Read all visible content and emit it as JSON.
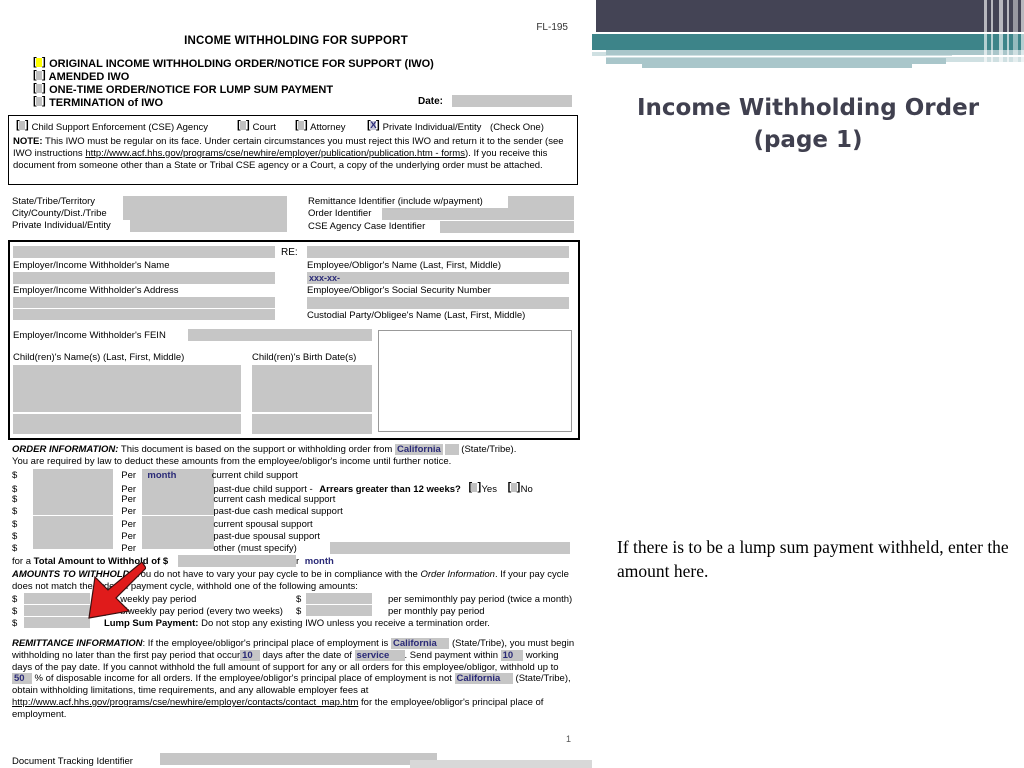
{
  "slide": {
    "title_line1": "Income Withholding Order",
    "title_line2": "(page 1)",
    "annotation": "If there is to be a lump sum payment withheld, enter the amount here.",
    "colors": {
      "navy": "#444455",
      "teal": "#3d8489",
      "pale": "#a9c6ca",
      "pale_light": "#cfe0e2",
      "arrow_red": "#e01b1b",
      "title_text": "#40404f"
    }
  },
  "form": {
    "form_number": "FL-195",
    "title": "INCOME WITHHOLDING FOR SUPPORT",
    "options": [
      {
        "label": "ORIGINAL INCOME WITHHOLDING ORDER/NOTICE FOR SUPPORT (IWO)",
        "checkbox": "highlighted-yellow"
      },
      {
        "label": "AMENDED IWO",
        "checkbox": "empty"
      },
      {
        "label": "ONE-TIME ORDER/NOTICE FOR LUMP SUM PAYMENT",
        "checkbox": "empty"
      },
      {
        "label": "TERMINATION of IWO",
        "checkbox": "empty"
      }
    ],
    "date_label": "Date:",
    "sender_row": {
      "options": [
        {
          "label": "Child Support Enforcement (CSE) Agency",
          "checked": false
        },
        {
          "label": "Court",
          "checked": false
        },
        {
          "label": "Attorney",
          "checked": false
        },
        {
          "label": "Private Individual/Entity",
          "checked": true
        }
      ],
      "instruction": "(Check One)"
    },
    "note": {
      "label": "NOTE:",
      "text1": "This IWO must be regular on its face. Under certain circumstances you must reject this IWO and return it to the sender (see IWO instructions",
      "link": "http://www.acf.hhs.gov/programs/cse/newhire/employer/publication/publication.htm - forms",
      "text2": ").",
      "text3": "If you receive this document from someone other than a State or Tribal CSE agency or a Court, a copy of the underlying order must be attached."
    },
    "id_left": [
      "State/Tribe/Territory",
      "City/County/Dist./Tribe",
      "Private Individual/Entity"
    ],
    "id_right": [
      "Remittance Identifier (include w/payment)",
      "Order Identifier",
      "CSE Agency Case Identifier"
    ],
    "party_box": {
      "re_label": "RE:",
      "employer_name_label": "Employer/Income Withholder's Name",
      "employer_address_label": "Employer/Income Withholder's Address",
      "employer_fein_label": "Employer/Income Withholder's FEIN",
      "employee_name_label": "Employee/Obligor's Name (Last, First, Middle)",
      "ssn_value": "xxx-xx-",
      "ssn_label": "Employee/Obligor's Social Security Number",
      "custodial_label": "Custodial Party/Obligee's Name (Last, First, Middle)",
      "children_names_label": "Child(ren)'s Name(s) (Last, First, Middle)",
      "children_dob_label": "Child(ren)'s Birth Date(s)"
    },
    "order_information": {
      "heading": "ORDER INFORMATION:",
      "intro1": "This document is based on the support or withholding order from",
      "state": "California",
      "state_suffix": "(State/Tribe).",
      "intro2": "You are required by law to deduct these amounts from the employee/obligor's income until further notice.",
      "rows": [
        {
          "per": "month",
          "desc": "current child support"
        },
        {
          "per": "",
          "desc": "past-due child support -"
        },
        {
          "per": "",
          "desc": "current cash medical support"
        },
        {
          "per": "",
          "desc": "past-due cash medical support"
        },
        {
          "per": "",
          "desc": "current spousal support"
        },
        {
          "per": "",
          "desc": "past-due spousal support"
        },
        {
          "per": "",
          "desc": "other (must specify)"
        }
      ],
      "arrears_question": "Arrears greater than 12 weeks?",
      "arrears_yes": "Yes",
      "arrears_no": "No",
      "total_prefix": "for a",
      "total_bold": "Total Amount to Withhold",
      "total_of": "of $",
      "total_per": "per",
      "total_per_value": "month"
    },
    "amounts_to_withhold": {
      "heading": "AMOUNTS TO WITHHOLD:",
      "intro": "You do not have to vary your pay cycle to be in compliance with the",
      "intro_italic": "Order Information",
      "intro2": ". If your pay cycle does not match the ordered payment cycle, withhold one of the following amounts:",
      "left_rows": [
        "per weekly pay period",
        "per biweekly pay period (every two weeks)"
      ],
      "right_rows": [
        "per semimonthly pay period (twice a month)",
        "per monthly pay period"
      ],
      "lump_sum_label": "Lump Sum Payment:",
      "lump_sum_text": "Do not stop any existing IWO unless you receive a termination order."
    },
    "remittance": {
      "heading": "REMITTANCE INFORMATION",
      "t1": ": If the employee/obligor's principal place of employment is",
      "state1": "California",
      "t2": "(State/Tribe), you must begin withholding no later than the first pay period that occur",
      "days1": "10",
      "t3": "days after the date of",
      "service": "service",
      "t4": ". Send payment within",
      "days2": "10",
      "t5": "working days of the pay date. If you cannot withhold the full amount of support for any or all orders for this employee/obligor, withhold up to",
      "pct": "50",
      "t6": "% of disposable income for all orders. If the employee/obligor's principal place of employment is not",
      "state2": "California",
      "t7": "(State/Tribe), obtain withholding limitations, time requirements, and any allowable employer fees at",
      "link": "http://www.acf.hhs.gov/programs/cse/newhire/employer/contacts/contact_map.htm",
      "t8": "for the employee/obligor's principal place of employment."
    },
    "page_number": "1",
    "document_tracking_label": "Document Tracking Identifier"
  }
}
